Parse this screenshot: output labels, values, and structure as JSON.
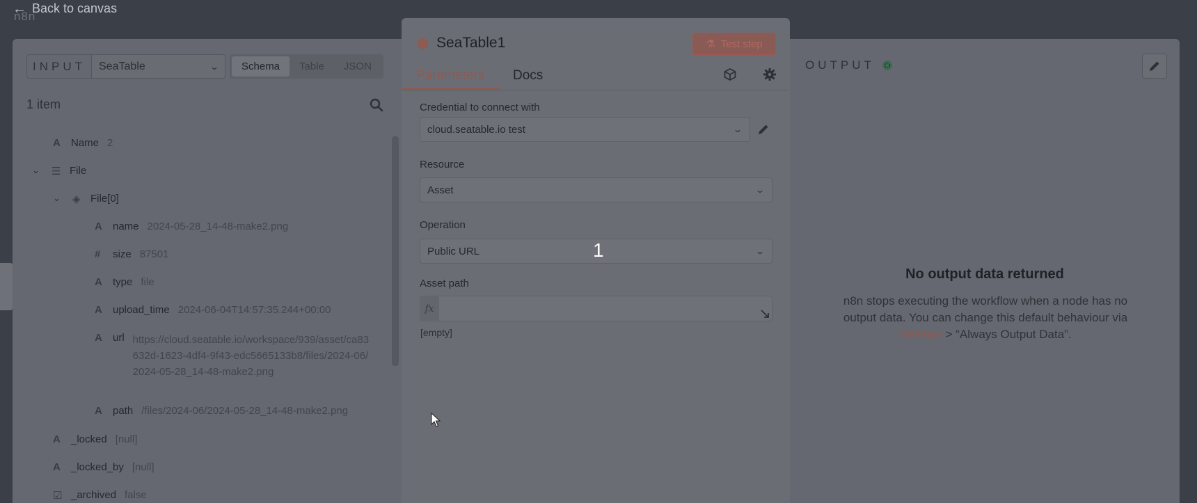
{
  "backdrop": {
    "back_link": "Back to canvas",
    "logo_text": "n8n"
  },
  "input": {
    "panel_label": "INPUT",
    "node_select_value": "SeaTable",
    "view_tabs": [
      "Schema",
      "Table",
      "JSON"
    ],
    "active_view": "Schema",
    "item_count": "1 item",
    "schema": [
      {
        "type": "A",
        "key": "Name",
        "value": "2"
      },
      {
        "type": "list",
        "key": "File",
        "value": ""
      },
      {
        "type": "obj",
        "key": "File[0]",
        "value": ""
      },
      {
        "type": "A",
        "key": "name",
        "value": "2024-05-28_14-48-make2.png"
      },
      {
        "type": "#",
        "key": "size",
        "value": "87501"
      },
      {
        "type": "A",
        "key": "type",
        "value": "file"
      },
      {
        "type": "A",
        "key": "upload_time",
        "value": "2024-06-04T14:57:35.244+00:00"
      },
      {
        "type": "A",
        "key": "url",
        "value": "https://cloud.seatable.io/workspace/939/asset/ca83632d-1623-4df4-9f43-edc5665133b8/files/2024-06/2024-05-28_14-48-make2.png"
      },
      {
        "type": "A",
        "key": "path",
        "value": "/files/2024-06/2024-05-28_14-48-make2.png"
      },
      {
        "type": "A",
        "key": "_locked",
        "value": "[null]"
      },
      {
        "type": "A",
        "key": "_locked_by",
        "value": "[null]"
      },
      {
        "type": "check",
        "key": "_archived",
        "value": "false"
      }
    ]
  },
  "params": {
    "node_title": "SeaTable1",
    "test_button": "Test step",
    "tabs": [
      "Parameters",
      "Docs"
    ],
    "active_tab": "Parameters",
    "credential_label": "Credential to connect with",
    "credential_value": "cloud.seatable.io test",
    "resource_label": "Resource",
    "resource_value": "Asset",
    "operation_label": "Operation",
    "operation_value": "Public URL",
    "asset_path_label": "Asset path",
    "asset_path_value": "",
    "fx_label": "fx",
    "empty_hint": "[empty]",
    "step_marker": "1"
  },
  "output": {
    "panel_label": "OUTPUT",
    "title": "No output data returned",
    "text_before_link": "n8n stops executing the workflow when a node has no output data. You can change this default behaviour via ",
    "link_text": "Settings",
    "text_after_link": " > “Always Output Data”."
  },
  "colors": {
    "accent": "#8e5a52",
    "overlay": "#656870"
  }
}
